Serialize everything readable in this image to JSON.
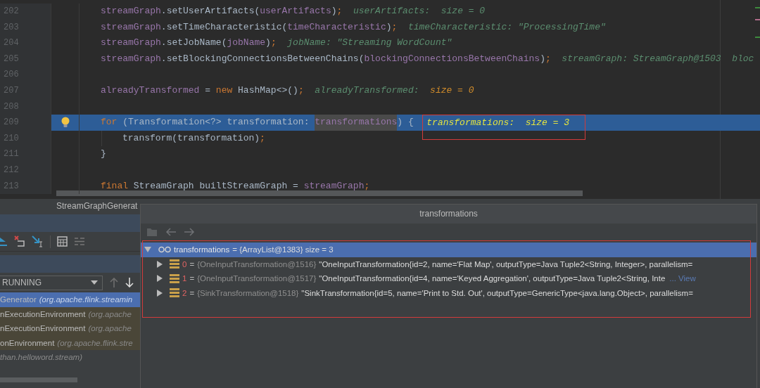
{
  "editor": {
    "lines": [
      {
        "number": "202",
        "kind": "outer",
        "current": false,
        "tokens": [
          {
            "kind": "field",
            "text": "streamGraph"
          },
          {
            "kind": "plain",
            "text": ".setUserArtifacts("
          },
          {
            "kind": "field",
            "text": "userArtifacts"
          },
          {
            "kind": "plain",
            "text": ")"
          },
          {
            "kind": "punct",
            "text": ";"
          }
        ],
        "hints": [
          {
            "kind": "hint",
            "text": "userArtifacts:  size = 0"
          }
        ]
      },
      {
        "number": "203",
        "kind": "outer",
        "current": false,
        "tokens": [
          {
            "kind": "field",
            "text": "streamGraph"
          },
          {
            "kind": "plain",
            "text": ".setTimeCharacteristic("
          },
          {
            "kind": "field",
            "text": "timeCharacteristic"
          },
          {
            "kind": "plain",
            "text": ")"
          },
          {
            "kind": "punct",
            "text": ";"
          }
        ],
        "hints": [
          {
            "kind": "hint",
            "text": "timeCharacteristic: \"ProcessingTime\""
          }
        ]
      },
      {
        "number": "204",
        "kind": "outer",
        "current": false,
        "tokens": [
          {
            "kind": "field",
            "text": "streamGraph"
          },
          {
            "kind": "plain",
            "text": ".setJobName("
          },
          {
            "kind": "field",
            "text": "jobName"
          },
          {
            "kind": "plain",
            "text": ")"
          },
          {
            "kind": "punct",
            "text": ";"
          }
        ],
        "hints": [
          {
            "kind": "hint",
            "text": "jobName: \"Streaming WordCount\""
          }
        ]
      },
      {
        "number": "205",
        "kind": "outer",
        "current": false,
        "tokens": [
          {
            "kind": "field",
            "text": "streamGraph"
          },
          {
            "kind": "plain",
            "text": ".setBlockingConnectionsBetweenChains("
          },
          {
            "kind": "field",
            "text": "blockingConnectionsBetweenChains"
          },
          {
            "kind": "plain",
            "text": ")"
          },
          {
            "kind": "punct",
            "text": ";"
          }
        ],
        "hints": [
          {
            "kind": "hint",
            "text": "streamGraph: StreamGraph@1503"
          },
          {
            "kind": "hint",
            "text": "bloc"
          }
        ]
      },
      {
        "number": "206",
        "kind": "outer",
        "current": false
      },
      {
        "number": "207",
        "kind": "outer",
        "current": false,
        "tokens": [
          {
            "kind": "field",
            "text": "alreadyTransformed"
          },
          {
            "kind": "plain",
            "text": " = "
          },
          {
            "kind": "keyword",
            "text": "new"
          },
          {
            "kind": "plain",
            "text": " HashMap<>()"
          },
          {
            "kind": "punct",
            "text": ";"
          }
        ],
        "hints": [
          {
            "kind": "hint",
            "text": "alreadyTransformed:"
          },
          {
            "kind": "changed",
            "text": "size = 0"
          }
        ]
      },
      {
        "number": "208",
        "kind": "outer",
        "current": false
      },
      {
        "number": "209",
        "kind": "outer",
        "current": true,
        "tokens": [
          {
            "kind": "keyword",
            "text": "for"
          },
          {
            "kind": "plain",
            "text": " (Transformation<?> transformation: "
          },
          {
            "kind": "marked",
            "text": "transformations"
          },
          {
            "kind": "plain",
            "text": ") {"
          }
        ],
        "hints": [
          {
            "kind": "current",
            "text": "transformations:  size = 3"
          }
        ]
      },
      {
        "number": "210",
        "kind": "inner",
        "current": false,
        "tokens": [
          {
            "kind": "plain",
            "text": "transform(transformation)"
          },
          {
            "kind": "punct",
            "text": ";"
          }
        ]
      },
      {
        "number": "211",
        "kind": "outer",
        "current": false,
        "tokens": [
          {
            "kind": "plain",
            "text": "}"
          }
        ]
      },
      {
        "number": "212",
        "kind": "outer",
        "current": false
      },
      {
        "number": "213",
        "kind": "outer",
        "current": false,
        "tokens": [
          {
            "kind": "keyword",
            "text": "final"
          },
          {
            "kind": "plain",
            "text": " StreamGraph builtStreamGraph = "
          },
          {
            "kind": "field",
            "text": "streamGraph"
          },
          {
            "kind": "punct",
            "text": ";"
          }
        ]
      }
    ]
  },
  "breadcrumb": "StreamGraphGenerat",
  "debugger": {
    "threads_dropdown": {
      "value": "RUNNING"
    },
    "frames": [
      {
        "method": "Generator",
        "location": "(org.apache.flink.streamin",
        "selected": true,
        "kind": "library"
      },
      {
        "method": "nExecutionEnvironment",
        "location": "(org.apache",
        "selected": false,
        "kind": "library"
      },
      {
        "method": "nExecutionEnvironment",
        "location": "(org.apache",
        "selected": false,
        "kind": "library"
      },
      {
        "method": "onEnvironment",
        "location": "(org.apache.flink.stre",
        "selected": false,
        "kind": "library"
      },
      {
        "location": "than.helloword.stream)",
        "selected": false,
        "kind": "project"
      }
    ]
  },
  "popup": {
    "title": "transformations",
    "tree": {
      "name": "transformations",
      "value": "= {ArrayList@1383}  size = 3",
      "expanded": true,
      "selected": true,
      "children": [
        {
          "index": "0",
          "separator": "=",
          "type": "{OneInputTransformation@1516}",
          "value": "\"OneInputTransformation{id=2, name='Flat Map', outputType=Java Tuple2<String, Integer>, parallelism=",
          "expanded": false,
          "selected": false
        },
        {
          "index": "1",
          "separator": "=",
          "type": "{OneInputTransformation@1517}",
          "value": "\"OneInputTransformation{id=4, name='Keyed Aggregation', outputType=Java Tuple2<String, Inte",
          "more_link": "... View",
          "expanded": false,
          "selected": false
        },
        {
          "index": "2",
          "separator": "=",
          "type": "{SinkTransformation@1518}",
          "value": "\"SinkTransformation{id=5, name='Print to Std. Out', outputType=GenericType<java.lang.Object>, parallelism=",
          "expanded": false,
          "selected": false
        }
      ]
    }
  }
}
